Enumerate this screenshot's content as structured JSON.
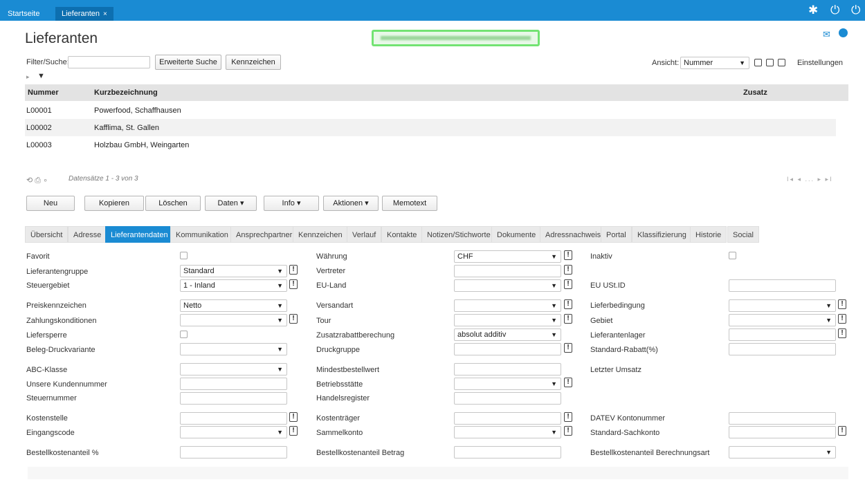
{
  "topbar": {
    "tab_home": "Startseite",
    "tab_active": "Lieferanten",
    "close": "×",
    "icons": [
      "gear-icon",
      "power-icon",
      "power-alt-icon"
    ]
  },
  "page": {
    "title": "Lieferanten"
  },
  "filter": {
    "label": "Filter/Suche:",
    "value": "",
    "extended_search": "Erweiterte Suche",
    "tags": "Kennzeichen",
    "view_label": "Ansicht:",
    "view_value": "Nummer",
    "settings": "Einstellungen"
  },
  "grid": {
    "columns": [
      "Nummer",
      "Kurzbezeichnung",
      "Zusatz"
    ],
    "rows": [
      {
        "nummer": "L00001",
        "kurz": "Powerfood, Schaffhausen",
        "zusatz": ""
      },
      {
        "nummer": "L00002",
        "kurz": "Kafflima, St. Gallen",
        "zusatz": ""
      },
      {
        "nummer": "L00003",
        "kurz": "Holzbau GmbH, Weingarten",
        "zusatz": ""
      }
    ],
    "records": "Datensätze 1 - 3 von 3",
    "pager": "I◂ ◂ ... ▸ ▸I"
  },
  "toolbar": {
    "neu": "Neu",
    "kopieren": "Kopieren",
    "loeschen": "Löschen",
    "daten": "Daten",
    "info": "Info",
    "aktionen": "Aktionen",
    "memotext": "Memotext"
  },
  "tabs": [
    "Übersicht",
    "Adresse",
    "Lieferantendaten",
    "Kommunikation",
    "Ansprechpartner",
    "Kennzeichen",
    "Verlauf",
    "Kontakte",
    "Notizen/Stichworte",
    "Dokumente",
    "Adressnachweis",
    "Portal",
    "Klassifizierung",
    "Historie",
    "Social"
  ],
  "form": {
    "col1": {
      "favorit": "Favorit",
      "lieferantengruppe": "Lieferantengruppe",
      "lieferantengruppe_val": "Standard",
      "steuergebiet": "Steuergebiet",
      "steuergebiet_val": "1 - Inland",
      "preiskennzeichen": "Preiskennzeichen",
      "preiskennzeichen_val": "Netto",
      "zahlungskonditionen": "Zahlungskonditionen",
      "liefersperre": "Liefersperre",
      "beleg": "Beleg-Druckvariante",
      "abc": "ABC-Klasse",
      "kundennummer": "Unsere Kundennummer",
      "steuernummer": "Steuernummer",
      "kostenstelle": "Kostenstelle",
      "eingangscode": "Eingangscode",
      "bestellkosten": "Bestellkostenanteil %"
    },
    "col2": {
      "waehrung": "Währung",
      "waehrung_val": "CHF",
      "vertreter": "Vertreter",
      "euland": "EU-Land",
      "versandart": "Versandart",
      "tour": "Tour",
      "zusatzrabatt": "Zusatzrabattberechung",
      "zusatzrabatt_val": "absolut additiv",
      "druckgruppe": "Druckgruppe",
      "mindestbestellwert": "Mindestbestellwert",
      "betriebsstaette": "Betriebsstätte",
      "handelsregister": "Handelsregister",
      "kostentraeger": "Kostenträger",
      "sammelkonto": "Sammelkonto",
      "bestellkosten_betrag": "Bestellkostenanteil Betrag"
    },
    "col3": {
      "inaktiv": "Inaktiv",
      "eu_ust": "EU USt.ID",
      "lieferbedingung": "Lieferbedingung",
      "gebiet": "Gebiet",
      "lieferantenlager": "Lieferantenlager",
      "standardrabatt": "Standard-Rabatt(%)",
      "letzter_umsatz": "Letzter Umsatz",
      "datev": "DATEV Kontonummer",
      "sachkonto": "Standard-Sachkonto",
      "berechnungsart": "Bestellkostenanteil Berechnungsart"
    }
  }
}
